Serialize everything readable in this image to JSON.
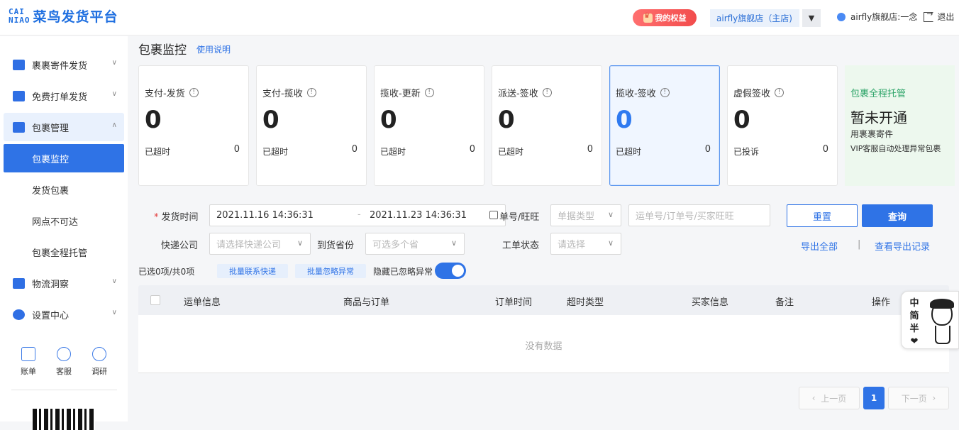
{
  "header": {
    "logo_mark_line1": "CAI",
    "logo_mark_line2": "NIAO",
    "logo_text": "菜鸟发货平台",
    "vip_label": "我的权益",
    "shop_name": "airfly旗舰店（主店)",
    "user_name": "airfly旗舰店:一念",
    "logout_label": "退出"
  },
  "sidebar": {
    "items": [
      {
        "label": "裹裹寄件发货",
        "icon": "package-send-icon"
      },
      {
        "label": "免费打单发货",
        "icon": "printer-icon"
      },
      {
        "label": "包裹管理",
        "icon": "parcel-manage-icon"
      },
      {
        "label": "物流洞察",
        "icon": "bar-chart-icon"
      },
      {
        "label": "设置中心",
        "icon": "gear-icon"
      }
    ],
    "sub_items": [
      "包裹监控",
      "发货包裹",
      "网点不可达",
      "包裹全程托管"
    ],
    "active_sub": "包裹监控",
    "quick": [
      {
        "label": "账单",
        "icon": "bill-icon"
      },
      {
        "label": "客服",
        "icon": "service-icon"
      },
      {
        "label": "调研",
        "icon": "survey-icon"
      }
    ]
  },
  "page": {
    "title": "包裹监控",
    "help_link": "使用说明"
  },
  "cards": [
    {
      "title": "支付-发货",
      "value": "0",
      "sub": "已超时",
      "count": "0",
      "active": false
    },
    {
      "title": "支付-揽收",
      "value": "0",
      "sub": "已超时",
      "count": "0",
      "active": false
    },
    {
      "title": "揽收-更新",
      "value": "0",
      "sub": "已超时",
      "count": "0",
      "active": false
    },
    {
      "title": "派送-签收",
      "value": "0",
      "sub": "已超时",
      "count": "0",
      "active": false
    },
    {
      "title": "揽收-签收",
      "value": "0",
      "sub": "已超时",
      "count": "0",
      "active": true
    },
    {
      "title": "虚假签收",
      "value": "0",
      "sub": "已投诉",
      "count": "0",
      "active": false
    }
  ],
  "promo": {
    "title": "包裹全程托管",
    "status": "暂未开通",
    "line1": "用裹裹寄件",
    "line2": "VIP客服自动处理异常包裹"
  },
  "filters": {
    "ship_time_label": "发货时间",
    "date_start": "2021.11.16 14:36:31",
    "date_sep": "-",
    "date_end": "2021.11.23 14:36:31",
    "order_no_label": "单号/旺旺",
    "order_type_placeholder": "单据类型",
    "order_search_placeholder": "运单号/订单号/买家旺旺",
    "courier_label": "快递公司",
    "courier_placeholder": "请选择快递公司",
    "province_label": "到货省份",
    "province_placeholder": "可选多个省",
    "ticket_label": "工单状态",
    "ticket_placeholder": "请选择",
    "reset_label": "重置",
    "query_label": "查询",
    "export_all": "导出全部",
    "export_divider": "|",
    "export_records": "查看导出记录"
  },
  "bulk": {
    "selected_text": "已选0项/共0项",
    "contact_courier": "批量联系快递",
    "ignore_exception": "批量忽略异常",
    "hide_ignored_label": "隐藏已忽略异常",
    "hide_ignored_on": true
  },
  "table": {
    "columns": [
      "运单信息",
      "商品与订单",
      "订单时间",
      "超时类型",
      "买家信息",
      "备注",
      "操作"
    ],
    "empty_text": "没有数据"
  },
  "pagination": {
    "prev": "上一页",
    "current": "1",
    "next": "下一页"
  },
  "mascot": {
    "text": [
      "中",
      "简",
      "半",
      "❤"
    ]
  }
}
